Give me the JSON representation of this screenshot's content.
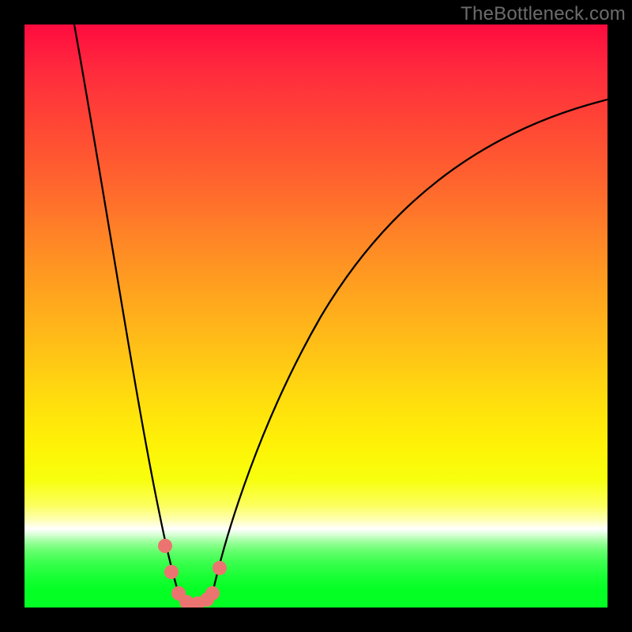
{
  "watermark": "TheBottleneck.com",
  "colors": {
    "frame": "#000000",
    "curve": "#000000",
    "markers": "#ec7470",
    "gradient_top": "#ff0b3f",
    "gradient_mid": "#ffd90f",
    "gradient_white_band": "#ffffff",
    "gradient_bottom": "#03ff24",
    "watermark_text": "#6c6c6c"
  },
  "chart_data": {
    "type": "line",
    "title": "",
    "xlabel": "",
    "ylabel": "",
    "xlim": [
      0,
      100
    ],
    "ylim": [
      0,
      100
    ],
    "x": [
      8.5,
      12,
      16,
      19.5,
      23,
      26.5,
      29,
      32.2,
      35,
      40,
      45,
      50,
      55,
      62,
      70,
      80,
      90,
      100
    ],
    "series": [
      {
        "name": "bottleneck-curve",
        "values": [
          100,
          80,
          60,
          40,
          20,
          2.4,
          0.8,
          2.4,
          10,
          28,
          42,
          52,
          60,
          68,
          75,
          81,
          85,
          87.5
        ]
      }
    ],
    "markers": {
      "x": [
        24.1,
        25.2,
        26.4,
        27.8,
        29.7,
        31.3,
        32.2,
        33.5
      ],
      "y": [
        10.6,
        6.1,
        2.4,
        1.0,
        0.7,
        1.4,
        2.4,
        6.8
      ],
      "color": "#ec7470"
    },
    "background_gradient": {
      "orientation": "vertical",
      "stops": [
        {
          "pos": 0.0,
          "color": "#ff0b3f"
        },
        {
          "pos": 0.36,
          "color": "#ff8327"
        },
        {
          "pos": 0.63,
          "color": "#ffd90f"
        },
        {
          "pos": 0.82,
          "color": "#fcff5e"
        },
        {
          "pos": 0.865,
          "color": "#ffffff"
        },
        {
          "pos": 0.9,
          "color": "#66ff6e"
        },
        {
          "pos": 1.0,
          "color": "#03ff24"
        }
      ]
    },
    "legend": null,
    "grid": false
  }
}
